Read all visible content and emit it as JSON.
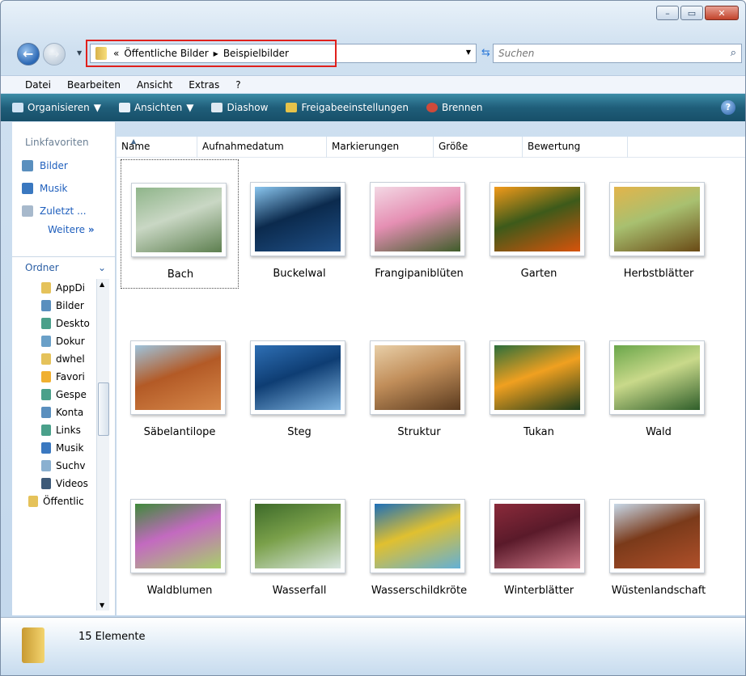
{
  "window": {
    "minimize": "–",
    "maximize": "▭",
    "close": "✕"
  },
  "nav": {
    "breadcrumb_prefix": "«",
    "crumbs": [
      "Öffentliche Bilder",
      "Beispielbilder"
    ],
    "search_placeholder": "Suchen"
  },
  "menu": [
    "Datei",
    "Bearbeiten",
    "Ansicht",
    "Extras",
    "?"
  ],
  "toolbar": {
    "organize": "Organisieren",
    "views": "Ansichten",
    "slideshow": "Diashow",
    "share": "Freigabeeinstellungen",
    "burn": "Brennen",
    "help": "?",
    "colors": {
      "bar": "#1f5e7a"
    }
  },
  "sidebar": {
    "favorites_title": "Linkfavoriten",
    "links": [
      "Bilder",
      "Musik",
      "Zuletzt ..."
    ],
    "more": "Weitere",
    "more_arrow": "»",
    "folders_title": "Ordner",
    "folders_chevron": "⌄",
    "tree": [
      "AppDi",
      "Bilder",
      "Deskto",
      "Dokur",
      "dwhel",
      "Favori",
      "Gespe",
      "Konta",
      "Links",
      "Musik",
      "Suchv",
      "Videos"
    ],
    "tree_root": "Öffentlic"
  },
  "columns": [
    "Name",
    "Aufnahmedatum",
    "Markierungen",
    "Größe",
    "Bewertung"
  ],
  "items": [
    {
      "name": "Bach",
      "colors": [
        "#8fb58a",
        "#5d7f4f",
        "#c9d7c4"
      ]
    },
    {
      "name": "Buckelwal",
      "colors": [
        "#8ac6ef",
        "#1f4f86",
        "#0b2a4d"
      ]
    },
    {
      "name": "Frangipaniblüten",
      "colors": [
        "#f3d8e4",
        "#3f5d2a",
        "#e58fb3"
      ]
    },
    {
      "name": "Garten",
      "colors": [
        "#f29a1a",
        "#d8530b",
        "#3d5a1a"
      ]
    },
    {
      "name": "Herbstblätter",
      "colors": [
        "#e3b44a",
        "#6a4a15",
        "#a8c070"
      ]
    },
    {
      "name": "Säbelantilope",
      "colors": [
        "#9ec3dc",
        "#d6884a",
        "#b35a26"
      ]
    },
    {
      "name": "Steg",
      "colors": [
        "#2e6fb4",
        "#7fb4e0",
        "#0e3d73"
      ]
    },
    {
      "name": "Struktur",
      "colors": [
        "#e8cfa8",
        "#5a3a1e",
        "#c18e5a"
      ]
    },
    {
      "name": "Tukan",
      "colors": [
        "#2b6e3b",
        "#1c3b1a",
        "#f0a020"
      ]
    },
    {
      "name": "Wald",
      "colors": [
        "#6aa64a",
        "#2f5e2a",
        "#c9d98a"
      ]
    },
    {
      "name": "Waldblumen",
      "colors": [
        "#3f8a3a",
        "#a8d06a",
        "#c36ac0"
      ]
    },
    {
      "name": "Wasserfall",
      "colors": [
        "#3d6a2a",
        "#d8e6e0",
        "#7aa04a"
      ]
    },
    {
      "name": "Wasserschildkröte",
      "colors": [
        "#1d6fb8",
        "#63b0d6",
        "#e0c030"
      ]
    },
    {
      "name": "Winterblätter",
      "colors": [
        "#8a2a3a",
        "#d07a8a",
        "#5a1a2a"
      ]
    },
    {
      "name": "Wüstenlandschaft",
      "colors": [
        "#c7d8e8",
        "#b0502a",
        "#7a3a1a"
      ]
    }
  ],
  "status": {
    "count": "15 Elemente"
  }
}
